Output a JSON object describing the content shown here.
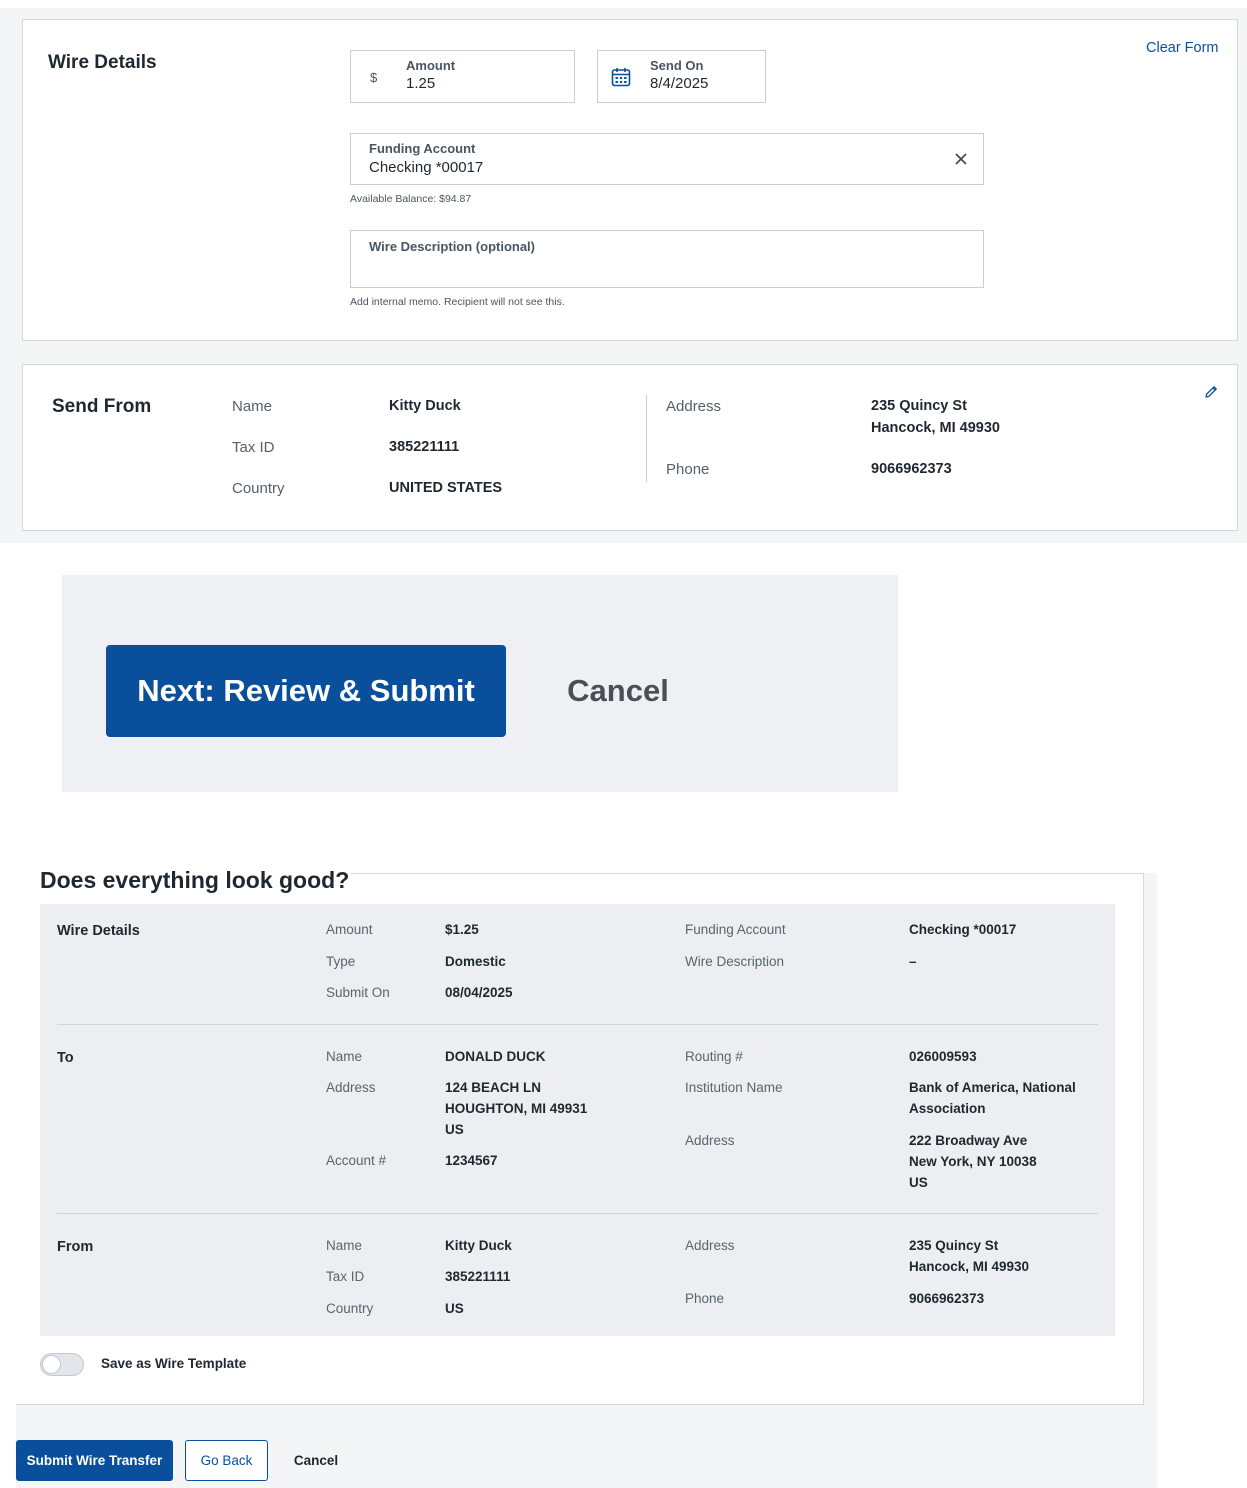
{
  "wire_details": {
    "title": "Wire Details",
    "clear_form": "Clear Form",
    "amount": {
      "label": "Amount",
      "prefix": "$",
      "value": "1.25"
    },
    "send_on": {
      "label": "Send On",
      "value": "8/4/2025"
    },
    "funding_account": {
      "label": "Funding Account",
      "value": "Checking *00017",
      "helper": "Available Balance: $94.87"
    },
    "wire_description": {
      "label": "Wire Description (optional)",
      "value": "",
      "helper": "Add internal memo. Recipient will not see this."
    }
  },
  "send_from": {
    "title": "Send From",
    "name_label": "Name",
    "name": "Kitty Duck",
    "tax_label": "Tax ID",
    "tax": "385221111",
    "country_label": "Country",
    "country": "UNITED STATES",
    "address_label": "Address",
    "address_1": "235 Quincy St",
    "address_2": "Hancock, MI 49930",
    "phone_label": "Phone",
    "phone": "9066962373"
  },
  "zoom_actions": {
    "next": "Next: Review & Submit",
    "cancel": "Cancel"
  },
  "review": {
    "title": "Does everything look good?",
    "wire": {
      "section": "Wire Details",
      "amount_label": "Amount",
      "amount": "$1.25",
      "type_label": "Type",
      "type": "Domestic",
      "submit_label": "Submit On",
      "submit": "08/04/2025",
      "funding_label": "Funding Account",
      "funding": "Checking *00017",
      "desc_label": "Wire Description",
      "desc": "–"
    },
    "to": {
      "section": "To",
      "name_label": "Name",
      "name": "DONALD DUCK",
      "address_label": "Address",
      "address_1": "124 BEACH LN",
      "address_2": "HOUGHTON, MI 49931",
      "address_3": "US",
      "account_label": "Account #",
      "account": "1234567",
      "routing_label": "Routing #",
      "routing": "026009593",
      "inst_label": "Institution Name",
      "inst_1": "Bank of America, National",
      "inst_2": "Association",
      "bank_address_label": "Address",
      "bank_address_1": "222 Broadway Ave",
      "bank_address_2": "New York, NY 10038",
      "bank_address_3": "US"
    },
    "from": {
      "section": "From",
      "name_label": "Name",
      "name": "Kitty Duck",
      "tax_label": "Tax ID",
      "tax": "385221111",
      "country_label": "Country",
      "country": "US",
      "address_label": "Address",
      "address_1": "235 Quincy St",
      "address_2": "Hancock, MI 49930",
      "phone_label": "Phone",
      "phone": "9066962373"
    },
    "save_template": {
      "label": "Save as Wire Template",
      "enabled": false
    }
  },
  "footer": {
    "submit": "Submit Wire Transfer",
    "go_back": "Go Back",
    "cancel": "Cancel"
  },
  "colors": {
    "primary": "#0a4f9c",
    "panel_bg": "#f4f5f7",
    "review_bg": "#eceef1"
  },
  "icons": {
    "calendar": "calendar-icon",
    "clear": "close-icon",
    "edit": "pencil-icon"
  }
}
